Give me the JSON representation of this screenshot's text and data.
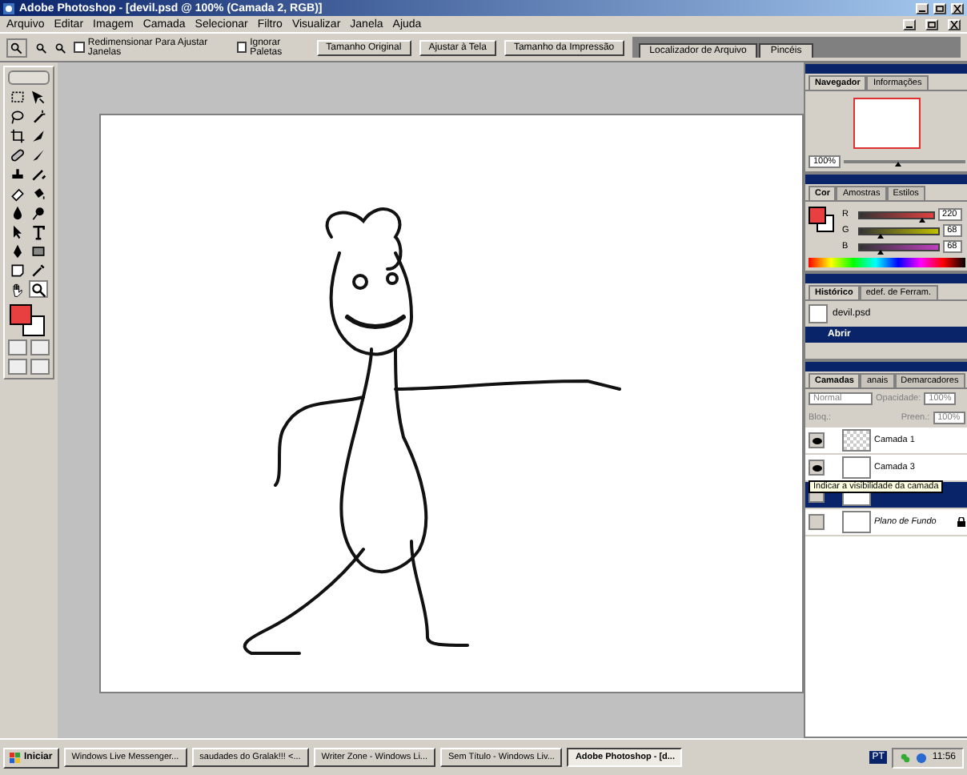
{
  "window": {
    "title": "Adobe Photoshop - [devil.psd @ 100% (Camada 2, RGB)]"
  },
  "menu": [
    "Arquivo",
    "Editar",
    "Imagem",
    "Camada",
    "Selecionar",
    "Filtro",
    "Visualizar",
    "Janela",
    "Ajuda"
  ],
  "options_bar": {
    "checkboxes": [
      {
        "label": "Redimensionar Para Ajustar Janelas",
        "checked": false
      },
      {
        "label": "Ignorar Paletas",
        "checked": false
      }
    ],
    "buttons": [
      "Tamanho Original",
      "Ajustar à Tela",
      "Tamanho da Impressão"
    ],
    "palette_well": [
      "Localizador de Arquivo",
      "Pincéis"
    ]
  },
  "toolbox": {
    "tools": [
      {
        "kind": "marquee",
        "selected": false
      },
      {
        "kind": "move",
        "selected": false
      },
      {
        "kind": "lasso",
        "selected": false
      },
      {
        "kind": "wand",
        "selected": false
      },
      {
        "kind": "crop",
        "selected": false
      },
      {
        "kind": "slice",
        "selected": false
      },
      {
        "kind": "heal",
        "selected": false
      },
      {
        "kind": "brush",
        "selected": false
      },
      {
        "kind": "stamp",
        "selected": false
      },
      {
        "kind": "history",
        "selected": false
      },
      {
        "kind": "eraser",
        "selected": false
      },
      {
        "kind": "bucket",
        "selected": false
      },
      {
        "kind": "drop",
        "selected": false
      },
      {
        "kind": "dodge",
        "selected": false
      },
      {
        "kind": "arrow",
        "selected": false
      },
      {
        "kind": "type",
        "selected": false
      },
      {
        "kind": "pen",
        "selected": false
      },
      {
        "kind": "shape",
        "selected": false
      },
      {
        "kind": "notes",
        "selected": false
      },
      {
        "kind": "eyedropper",
        "selected": false
      },
      {
        "kind": "hand",
        "selected": false
      },
      {
        "kind": "zoom",
        "selected": true
      }
    ]
  },
  "navigator": {
    "tabs": [
      {
        "label": "Navegador",
        "selected": true
      },
      {
        "label": "Informações",
        "selected": false
      }
    ],
    "zoom": "100%",
    "level": 0.45
  },
  "color": {
    "tabs": [
      {
        "label": "Cor",
        "selected": true
      },
      {
        "label": "Amostras",
        "selected": false
      },
      {
        "label": "Estilos",
        "selected": false
      }
    ],
    "channels": [
      {
        "name": "R",
        "value": "220",
        "level": 0.86
      },
      {
        "name": "G",
        "value": "68",
        "level": 0.27
      },
      {
        "name": "B",
        "value": "68",
        "level": 0.27
      }
    ]
  },
  "history": {
    "tabs": [
      {
        "label": "Histórico",
        "selected": true
      },
      {
        "label": "edef. de Ferram.",
        "selected": false
      }
    ],
    "snapshot": "devil.psd",
    "steps": [
      {
        "label": "Abrir",
        "selected": true
      }
    ]
  },
  "layers": {
    "tabs": [
      {
        "label": "Camadas",
        "selected": true
      },
      {
        "label": "anais",
        "selected": false
      },
      {
        "label": "Demarcadores",
        "selected": false
      }
    ],
    "blend_mode": "Normal",
    "opacity_label": "Opacidade:",
    "opacity": "100%",
    "lock_label": "Bloq.:",
    "fill_label": "Preen.:",
    "fill": "100%",
    "items": [
      {
        "name": "Camada 1",
        "visible": true,
        "selected": false,
        "kind": "transparent"
      },
      {
        "name": "Camada 3",
        "visible": true,
        "selected": false,
        "kind": "white"
      },
      {
        "visible": false,
        "selected": true,
        "kind": "figure"
      },
      {
        "name": "Plano de Fundo",
        "visible": false,
        "selected": false,
        "kind": "background"
      }
    ],
    "tooltip": "Indicar a visibilidade da camada"
  },
  "taskbar": {
    "start": "Iniciar",
    "items": [
      {
        "label": "Windows Live Messenger...",
        "selected": false
      },
      {
        "label": "saudades do Gralak!!! <...",
        "selected": false
      },
      {
        "label": "Writer Zone - Windows Li...",
        "selected": false
      },
      {
        "label": "Sem Título - Windows Liv...",
        "selected": false
      },
      {
        "label": "Adobe Photoshop - [d...",
        "selected": true
      }
    ],
    "language": "PT",
    "clock": "11:56"
  }
}
